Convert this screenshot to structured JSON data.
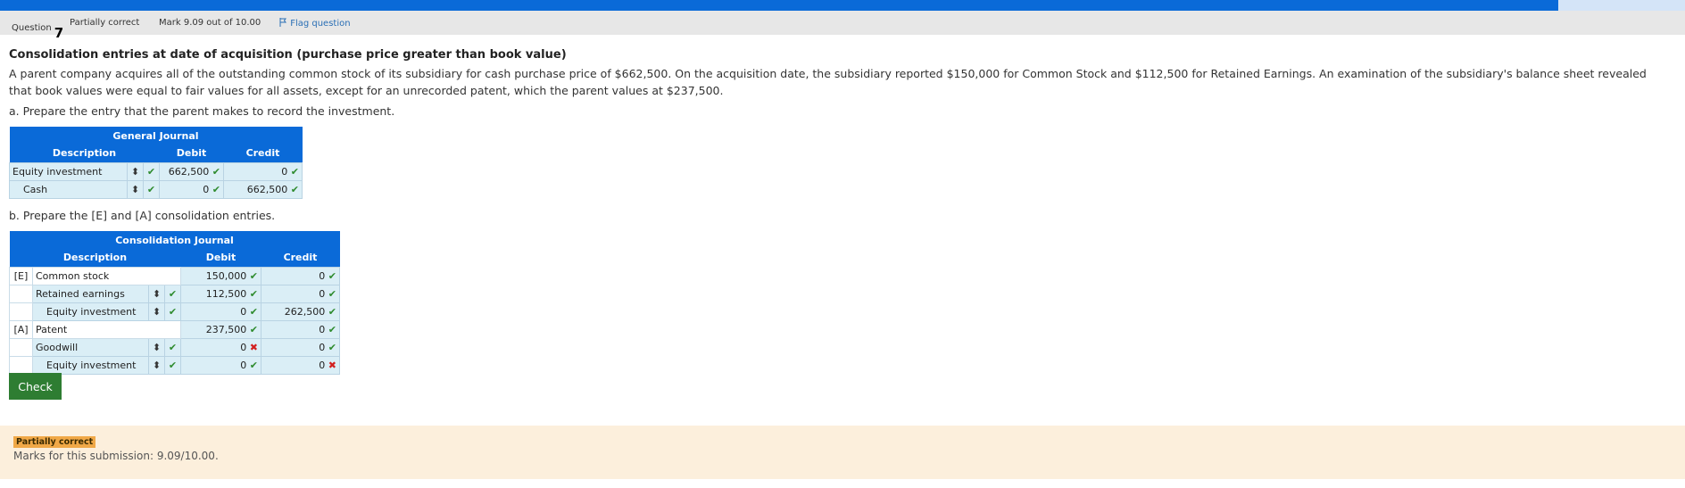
{
  "header": {
    "question_label": "Question",
    "question_number": "7",
    "status": "Partially correct",
    "mark": "Mark 9.09 out of 10.00",
    "flag_label": "Flag question"
  },
  "question": {
    "title": "Consolidation entries at date of acquisition (purchase price greater than book value)",
    "body": "A parent company acquires all of the outstanding common stock of its subsidiary for cash purchase price of $662,500. On the acquisition date, the subsidiary reported $150,000 for Common Stock and $112,500 for Retained Earnings. An examination of the subsidiary's balance sheet revealed that book values were equal to fair values for all assets, except for an unrecorded patent, which the parent values at $237,500.",
    "prompt_a": "a. Prepare the entry that the parent makes to record the investment.",
    "prompt_b": "b. Prepare the [E] and [A] consolidation entries."
  },
  "general_journal": {
    "title": "General Journal",
    "headers": {
      "description": "Description",
      "debit": "Debit",
      "credit": "Credit"
    },
    "rows": [
      {
        "description": "Equity investment",
        "debit": "662,500",
        "credit": "0"
      },
      {
        "description": "Cash",
        "debit": "0",
        "credit": "662,500"
      }
    ]
  },
  "consolidation_journal": {
    "title": "Consolidation Journal",
    "headers": {
      "description": "Description",
      "debit": "Debit",
      "credit": "Credit"
    },
    "rows": [
      {
        "tag": "[E]",
        "description": "Common stock",
        "debit": "150,000",
        "credit": "0"
      },
      {
        "tag": "",
        "description": "Retained earnings",
        "debit": "112,500",
        "credit": "0"
      },
      {
        "tag": "",
        "description": "Equity investment",
        "debit": "0",
        "credit": "262,500"
      },
      {
        "tag": "[A]",
        "description": "Patent",
        "debit": "237,500",
        "credit": "0"
      },
      {
        "tag": "",
        "description": "Goodwill",
        "debit": "0",
        "credit": "0"
      },
      {
        "tag": "",
        "description": "Equity investment",
        "debit": "0",
        "credit": "0"
      }
    ]
  },
  "check_button": "Check",
  "feedback": {
    "badge": "Partially correct",
    "marks": "Marks for this submission: 9.09/10.00."
  },
  "icons": {
    "correct": "check-icon",
    "incorrect": "cross-icon",
    "sort": "sort-arrows-icon",
    "flag": "flag-icon"
  },
  "colors": {
    "accent": "#0a6ad8",
    "correct": "#2e8b2e",
    "incorrect": "#d21f1f",
    "check_button": "#2e7d32",
    "feedback_bg": "#fcefdc",
    "badge": "#f0a847"
  }
}
